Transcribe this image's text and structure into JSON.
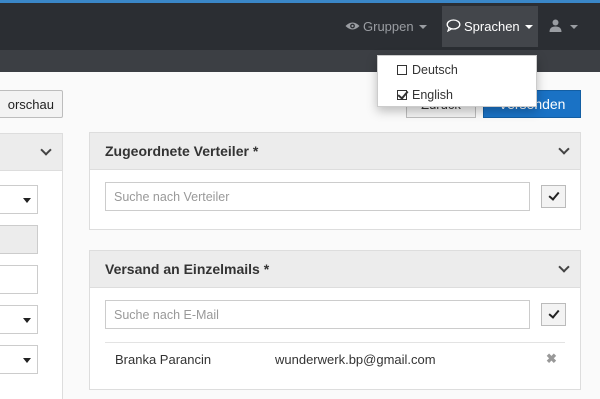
{
  "navbar": {
    "gruppen": {
      "label": "Gruppen",
      "icon": "eye-icon"
    },
    "sprachen": {
      "label": "Sprachen",
      "icon": "speech-bubble-icon"
    },
    "user": {
      "icon": "user-icon"
    }
  },
  "language_menu": {
    "items": [
      {
        "label": "Deutsch",
        "checked": false
      },
      {
        "label": "English",
        "checked": true
      }
    ]
  },
  "actions": {
    "vorschau": "orschau",
    "zurueck": "Zurück",
    "versenden": "Versenden"
  },
  "verteiler_panel": {
    "title": "Zugeordnete Verteiler *",
    "search_placeholder": "Suche nach Verteiler"
  },
  "einzelmails_panel": {
    "title": "Versand an Einzelmails *",
    "search_placeholder": "Suche nach E-Mail",
    "recipients": [
      {
        "name": "Branka Parancin",
        "email": "wunderwerk.bp@gmail.com",
        "remove": "✖"
      }
    ]
  },
  "colors": {
    "accent": "#1a72c5",
    "topbar": "#2b2e33",
    "topbar_border": "#3a87c8"
  }
}
